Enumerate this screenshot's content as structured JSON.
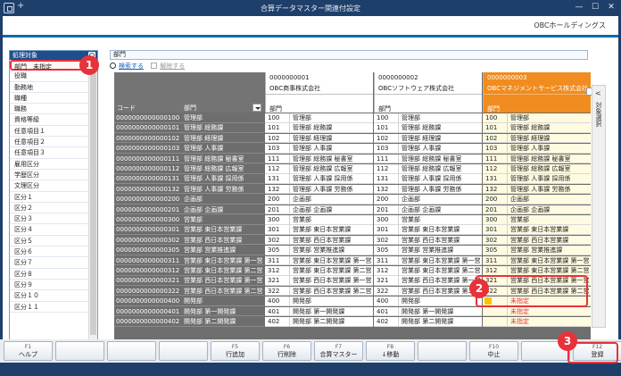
{
  "window": {
    "title": "合算データマスター関連付設定",
    "minimize": "—",
    "maximize": "☐",
    "close": "✕",
    "new_tab": "+"
  },
  "brand": "OBCホールディングス",
  "left_panel": {
    "header": "処理対象",
    "selected": "部門　未指定",
    "items": [
      "役職",
      "勤務地",
      "職種",
      "職務",
      "資格等級",
      "任意項目１",
      "任意項目２",
      "任意項目３",
      "雇用区分",
      "学歴区分",
      "文理区分",
      "区分１",
      "区分２",
      "区分３",
      "区分４",
      "区分５",
      "区分６",
      "区分７",
      "区分８",
      "区分９",
      "区分１０",
      "区分１１"
    ]
  },
  "dept_field": "部門",
  "tools": {
    "search": "検索する",
    "release": "解除する"
  },
  "grid": {
    "left_headers": {
      "code": "コード",
      "name": "部門"
    },
    "companies": [
      {
        "code": "0000000001",
        "name": "OBC商事株式会社",
        "sub": "部門"
      },
      {
        "code": "0000000002",
        "name": "OBCソフトウェア株式会社",
        "sub": "部門"
      },
      {
        "code": "0000000003",
        "name": "OBCマネジメントサービス株式会社",
        "sub": "部門"
      }
    ],
    "rows": [
      {
        "code": "0000000000000100",
        "name": "管理部",
        "v": [
          [
            "100",
            "管理部"
          ],
          [
            "100",
            "管理部"
          ],
          [
            "100",
            "管理部"
          ]
        ]
      },
      {
        "code": "0000000000000101",
        "name": "管理部 総務課",
        "v": [
          [
            "101",
            "管理部 総務課"
          ],
          [
            "101",
            "管理部 総務課"
          ],
          [
            "101",
            "管理部 総務課"
          ]
        ]
      },
      {
        "code": "0000000000000102",
        "name": "管理部 経理課",
        "v": [
          [
            "102",
            "管理部 経理課"
          ],
          [
            "102",
            "管理部 経理課"
          ],
          [
            "102",
            "管理部 経理課"
          ]
        ]
      },
      {
        "code": "0000000000000103",
        "name": "管理部 人事課",
        "v": [
          [
            "103",
            "管理部 人事課"
          ],
          [
            "103",
            "管理部 人事課"
          ],
          [
            "103",
            "管理部 人事課"
          ]
        ]
      },
      {
        "code": "0000000000000111",
        "name": "管理部 総務課 秘書室",
        "v": [
          [
            "111",
            "管理部 総務課 秘書室"
          ],
          [
            "111",
            "管理部 総務課 秘書室"
          ],
          [
            "111",
            "管理部 総務課 秘書室"
          ]
        ]
      },
      {
        "code": "0000000000000112",
        "name": "管理部 総務課 広報室",
        "v": [
          [
            "112",
            "管理部 総務課 広報室"
          ],
          [
            "112",
            "管理部 総務課 広報室"
          ],
          [
            "112",
            "管理部 総務課 広報室"
          ]
        ]
      },
      {
        "code": "0000000000000131",
        "name": "管理部 人事課 採用係",
        "v": [
          [
            "131",
            "管理部 人事課 採用係"
          ],
          [
            "131",
            "管理部 人事課 採用係"
          ],
          [
            "131",
            "管理部 人事課 採用係"
          ]
        ]
      },
      {
        "code": "0000000000000132",
        "name": "管理部 人事課 労務係",
        "v": [
          [
            "132",
            "管理部 人事課 労務係"
          ],
          [
            "132",
            "管理部 人事課 労務係"
          ],
          [
            "132",
            "管理部 人事課 労務係"
          ]
        ]
      },
      {
        "code": "0000000000000200",
        "name": "企画部",
        "v": [
          [
            "200",
            "企画部"
          ],
          [
            "200",
            "企画部"
          ],
          [
            "200",
            "企画部"
          ]
        ]
      },
      {
        "code": "0000000000000201",
        "name": "企画部 企画課",
        "v": [
          [
            "201",
            "企画部 企画課"
          ],
          [
            "201",
            "企画部 企画課"
          ],
          [
            "201",
            "企画部 企画課"
          ]
        ]
      },
      {
        "code": "0000000000000300",
        "name": "営業部",
        "v": [
          [
            "300",
            "営業部"
          ],
          [
            "300",
            "営業部"
          ],
          [
            "300",
            "営業部"
          ]
        ]
      },
      {
        "code": "0000000000000301",
        "name": "営業部 東日本営業課",
        "v": [
          [
            "301",
            "営業部 東日本営業課"
          ],
          [
            "301",
            "営業部 東日本営業課"
          ],
          [
            "301",
            "営業部 東日本営業課"
          ]
        ]
      },
      {
        "code": "0000000000000302",
        "name": "営業部 西日本営業課",
        "v": [
          [
            "302",
            "営業部 西日本営業課"
          ],
          [
            "302",
            "営業部 西日本営業課"
          ],
          [
            "302",
            "営業部 西日本営業課"
          ]
        ]
      },
      {
        "code": "0000000000000305",
        "name": "営業部 営業推進課",
        "v": [
          [
            "305",
            "営業部 営業推進課"
          ],
          [
            "305",
            "営業部 営業推進課"
          ],
          [
            "305",
            "営業部 営業推進課"
          ]
        ]
      },
      {
        "code": "0000000000000311",
        "name": "営業部 東日本営業課 第一営",
        "v": [
          [
            "311",
            "営業部 東日本営業課 第一営"
          ],
          [
            "311",
            "営業部 東日本営業課 第一営"
          ],
          [
            "311",
            "営業部 東日本営業課 第一営"
          ]
        ]
      },
      {
        "code": "0000000000000312",
        "name": "営業部 東日本営業課 第二営",
        "v": [
          [
            "312",
            "営業部 東日本営業課 第二営"
          ],
          [
            "312",
            "営業部 東日本営業課 第二営"
          ],
          [
            "312",
            "営業部 東日本営業課 第二営"
          ]
        ]
      },
      {
        "code": "0000000000000321",
        "name": "営業部 西日本営業課 第一営",
        "v": [
          [
            "321",
            "営業部 西日本営業課 第一営"
          ],
          [
            "321",
            "営業部 西日本営業課 第一営"
          ],
          [
            "321",
            "営業部 西日本営業課 第一営"
          ]
        ]
      },
      {
        "code": "0000000000000322",
        "name": "営業部 西日本営業課 第二営",
        "v": [
          [
            "322",
            "営業部 西日本営業課 第二営"
          ],
          [
            "322",
            "営業部 西日本営業課 第二営"
          ],
          [
            "322",
            "営業部 西日本営業課 第二営"
          ]
        ]
      },
      {
        "code": "0000000000000400",
        "name": "開発部",
        "v": [
          [
            "400",
            "開発部"
          ],
          [
            "400",
            "開発部"
          ],
          [
            "",
            "未指定"
          ]
        ]
      },
      {
        "code": "0000000000000401",
        "name": "開発部 第一開発課",
        "v": [
          [
            "401",
            "開発部 第一開発課"
          ],
          [
            "401",
            "開発部 第一開発課"
          ],
          [
            "",
            "未指定"
          ]
        ]
      },
      {
        "code": "0000000000000402",
        "name": "開発部 第二開発課",
        "v": [
          [
            "402",
            "開発部 第二開発課"
          ],
          [
            "402",
            "開発部 第二開発課"
          ],
          [
            "",
            "未指定"
          ]
        ]
      }
    ]
  },
  "right_panel": {
    "label": "対象選択",
    "chevron": "<"
  },
  "function_keys": [
    {
      "key": "F1",
      "label": "ヘルプ"
    },
    {
      "key": "",
      "label": ""
    },
    {
      "key": "",
      "label": ""
    },
    {
      "key": "",
      "label": ""
    },
    {
      "key": "F5",
      "label": "行追加"
    },
    {
      "key": "F6",
      "label": "行削除"
    },
    {
      "key": "F7",
      "label": "合算マスター"
    },
    {
      "key": "F8",
      "label": "↓移動"
    },
    {
      "key": "",
      "label": ""
    },
    {
      "key": "F10",
      "label": "中止"
    },
    {
      "key": "",
      "label": ""
    },
    {
      "key": "F12",
      "label": "登録"
    }
  ],
  "callouts": [
    "1",
    "2",
    "3"
  ],
  "colors": {
    "accent_red": "#e8323a",
    "header_orange": "#f08c20",
    "title_navy": "#1f3f6b"
  }
}
